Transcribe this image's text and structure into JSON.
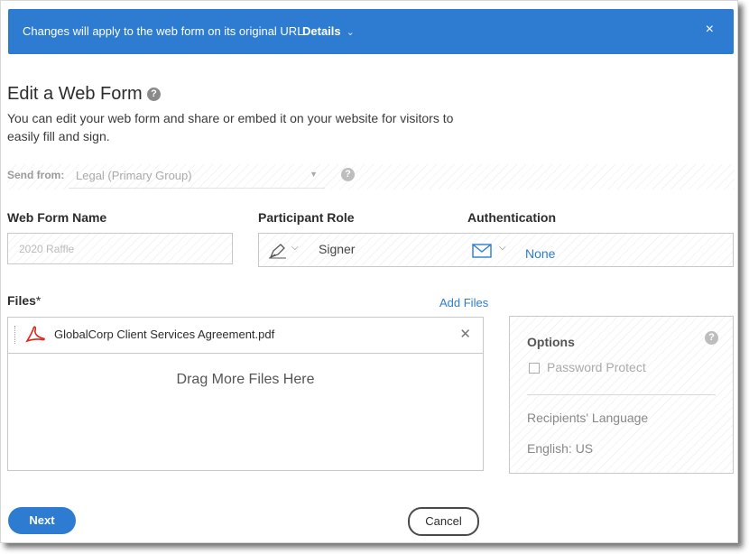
{
  "banner": {
    "message": "Changes will apply to the web form on its original URL.",
    "details_label": "Details",
    "close_glyph": "×"
  },
  "header": {
    "title": "Edit a Web Form",
    "subtitle": "You can edit your web form and share or embed it on your website for visitors to easily fill and sign.",
    "help_glyph": "?"
  },
  "send_from": {
    "label": "Send from:",
    "value": "Legal (Primary Group)",
    "caret": "▼",
    "help_glyph": "?"
  },
  "web_form_name": {
    "label": "Web Form Name",
    "value": "2020 Raffle"
  },
  "participant_role": {
    "label": "Participant Role",
    "value": "Signer",
    "icon": "pen-icon",
    "chevron": "⌵"
  },
  "authentication": {
    "label": "Authentication",
    "value": "None",
    "icon": "envelope-icon",
    "chevron": "⌵"
  },
  "files": {
    "label": "Files",
    "required_marker": "*",
    "add_files_label": "Add Files",
    "items": [
      {
        "name": "GlobalCorp Client Services Agreement.pdf",
        "icon": "pdf-icon",
        "remove_glyph": "✕"
      }
    ],
    "drop_zone_text": "Drag More Files Here"
  },
  "options": {
    "title": "Options",
    "help_glyph": "?",
    "password_protect_label": "Password Protect",
    "password_protect_checked": false,
    "recipients_language_label": "Recipients' Language",
    "recipients_language_value": "English: US"
  },
  "footer": {
    "next_label": "Next",
    "cancel_label": "Cancel"
  },
  "colors": {
    "accent": "#2d7cd1",
    "text": "#2c2c2c",
    "border": "#c8c8c8"
  }
}
